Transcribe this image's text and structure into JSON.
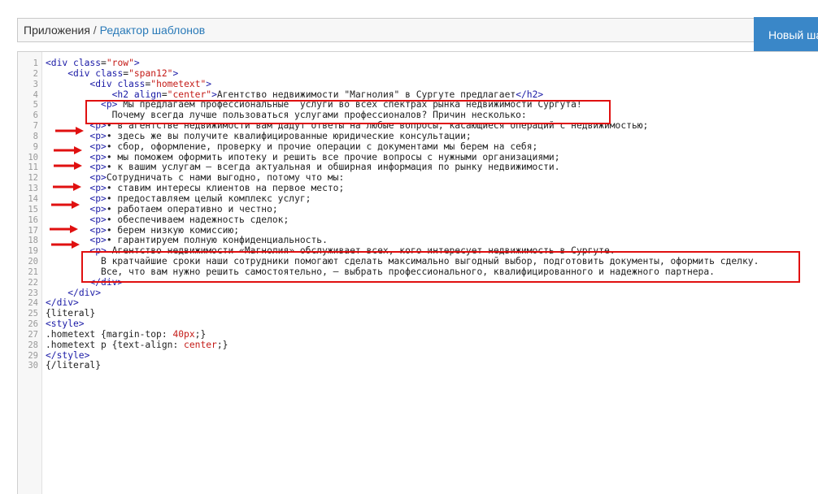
{
  "breadcrumb": {
    "root": "Приложения",
    "separator": " / ",
    "current": "Редактор шаблонов"
  },
  "toolbar": {
    "new_button_label": "Новый шаблон"
  },
  "colors": {
    "accent": "#3a87c8",
    "highlight": "#e01010",
    "tag": "#1a1aa6",
    "string": "#c41a16"
  },
  "code_lines": [
    {
      "n": "1",
      "tokens": [
        [
          "tag",
          "<div"
        ],
        [
          "text",
          " "
        ],
        [
          "attr",
          "class"
        ],
        [
          "text",
          "="
        ],
        [
          "val",
          "\"row\""
        ],
        [
          "tag",
          ">"
        ]
      ]
    },
    {
      "n": "2",
      "tokens": [
        [
          "text",
          "    "
        ],
        [
          "tag",
          "<div"
        ],
        [
          "text",
          " "
        ],
        [
          "attr",
          "class"
        ],
        [
          "text",
          "="
        ],
        [
          "val",
          "\"span12\""
        ],
        [
          "tag",
          ">"
        ]
      ]
    },
    {
      "n": "3",
      "tokens": [
        [
          "text",
          "        "
        ],
        [
          "tag",
          "<div"
        ],
        [
          "text",
          " "
        ],
        [
          "attr",
          "class"
        ],
        [
          "text",
          "="
        ],
        [
          "val",
          "\"hometext\""
        ],
        [
          "tag",
          ">"
        ]
      ]
    },
    {
      "n": "4",
      "tokens": [
        [
          "text",
          "            "
        ],
        [
          "tag",
          "<h2"
        ],
        [
          "text",
          " "
        ],
        [
          "attr",
          "align"
        ],
        [
          "text",
          "="
        ],
        [
          "val",
          "\"center\""
        ],
        [
          "tag",
          ">"
        ],
        [
          "text",
          "Агентство недвижимости \"Магнолия\" в Сургуте предлагает"
        ],
        [
          "tag",
          "</h2>"
        ]
      ]
    },
    {
      "n": "5",
      "tokens": [
        [
          "text",
          "          "
        ],
        [
          "tag",
          "<p>"
        ],
        [
          "text",
          " Мы предлагаем профессиональные  услуги во всех спектрах рынка недвижимости Сургута!"
        ]
      ]
    },
    {
      "n": "6",
      "tokens": [
        [
          "text",
          "            Почему всегда лучше пользоваться услугами профессионалов? Причин несколько:"
        ]
      ]
    },
    {
      "n": "7",
      "tokens": [
        [
          "text",
          "        "
        ],
        [
          "tag",
          "<p>"
        ],
        [
          "text",
          "• в агентстве недвижимости вам дадут ответы на любые вопросы, касающиеся операций с недвижимостью;"
        ]
      ]
    },
    {
      "n": "8",
      "tokens": [
        [
          "text",
          "        "
        ],
        [
          "tag",
          "<p>"
        ],
        [
          "text",
          "• здесь же вы получите квалифицированные юридические консультации;"
        ]
      ]
    },
    {
      "n": "9",
      "tokens": [
        [
          "text",
          "        "
        ],
        [
          "tag",
          "<p>"
        ],
        [
          "text",
          "• сбор, оформление, проверку и прочие операции с документами мы берем на себя;"
        ]
      ]
    },
    {
      "n": "10",
      "tokens": [
        [
          "text",
          "        "
        ],
        [
          "tag",
          "<p>"
        ],
        [
          "text",
          "• мы поможем оформить ипотеку и решить все прочие вопросы с нужными организациями;"
        ]
      ]
    },
    {
      "n": "11",
      "tokens": [
        [
          "text",
          "        "
        ],
        [
          "tag",
          "<p>"
        ],
        [
          "text",
          "• к вашим услугам – всегда актуальная и обширная информация по рынку недвижимости."
        ]
      ]
    },
    {
      "n": "12",
      "tokens": [
        [
          "text",
          "        "
        ],
        [
          "tag",
          "<p>"
        ],
        [
          "text",
          "Сотрудничать с нами выгодно, потому что мы:"
        ]
      ]
    },
    {
      "n": "13",
      "tokens": [
        [
          "text",
          "        "
        ],
        [
          "tag",
          "<p>"
        ],
        [
          "text",
          "• ставим интересы клиентов на первое место;"
        ]
      ]
    },
    {
      "n": "14",
      "tokens": [
        [
          "text",
          "        "
        ],
        [
          "tag",
          "<p>"
        ],
        [
          "text",
          "• предоставляем целый комплекс услуг;"
        ]
      ]
    },
    {
      "n": "15",
      "tokens": [
        [
          "text",
          "        "
        ],
        [
          "tag",
          "<p>"
        ],
        [
          "text",
          "• работаем оперативно и честно;"
        ]
      ]
    },
    {
      "n": "16",
      "tokens": [
        [
          "text",
          "        "
        ],
        [
          "tag",
          "<p>"
        ],
        [
          "text",
          "• обеспечиваем надежность сделок;"
        ]
      ]
    },
    {
      "n": "17",
      "tokens": [
        [
          "text",
          "        "
        ],
        [
          "tag",
          "<p>"
        ],
        [
          "text",
          "• берем низкую комиссию;"
        ]
      ]
    },
    {
      "n": "18",
      "tokens": [
        [
          "text",
          "        "
        ],
        [
          "tag",
          "<p>"
        ],
        [
          "text",
          "• гарантируем полную конфиденциальность."
        ]
      ]
    },
    {
      "n": "19",
      "tokens": [
        [
          "text",
          "        "
        ],
        [
          "tag",
          "<p>"
        ],
        [
          "text",
          " Агентство недвижимости «Магнолия» обслуживает всех, кого интересует недвижимость в Сургуте."
        ]
      ]
    },
    {
      "n": "20",
      "tokens": [
        [
          "text",
          "          В кратчайшие сроки наши сотрудники помогают сделать максимально выгодный выбор, подготовить документы, оформить сделку."
        ]
      ]
    },
    {
      "n": "21",
      "tokens": [
        [
          "text",
          "          Все, что вам нужно решить самостоятельно, – выбрать профессионального, квалифицированного и надежного партнера."
        ]
      ]
    },
    {
      "n": "22",
      "tokens": [
        [
          "text",
          "        "
        ],
        [
          "tag",
          "</div>"
        ]
      ]
    },
    {
      "n": "23",
      "tokens": [
        [
          "text",
          "    "
        ],
        [
          "tag",
          "</div>"
        ]
      ]
    },
    {
      "n": "24",
      "tokens": [
        [
          "tag",
          "</div>"
        ]
      ]
    },
    {
      "n": "25",
      "tokens": [
        [
          "text",
          "{literal}"
        ]
      ]
    },
    {
      "n": "26",
      "tokens": [
        [
          "tag",
          "<style>"
        ]
      ]
    },
    {
      "n": "27",
      "tokens": [
        [
          "text",
          ".hometext {"
        ],
        [
          "prop",
          "margin-top"
        ],
        [
          "text",
          ": "
        ],
        [
          "num",
          "40px"
        ],
        [
          "text",
          ";}"
        ]
      ]
    },
    {
      "n": "28",
      "tokens": [
        [
          "text",
          ".hometext p {"
        ],
        [
          "prop",
          "text-align"
        ],
        [
          "text",
          ": "
        ],
        [
          "num",
          "center"
        ],
        [
          "text",
          ";}"
        ]
      ]
    },
    {
      "n": "29",
      "tokens": [
        [
          "tag",
          "</style>"
        ]
      ]
    },
    {
      "n": "30",
      "tokens": [
        [
          "text",
          "{/literal}"
        ]
      ]
    }
  ]
}
